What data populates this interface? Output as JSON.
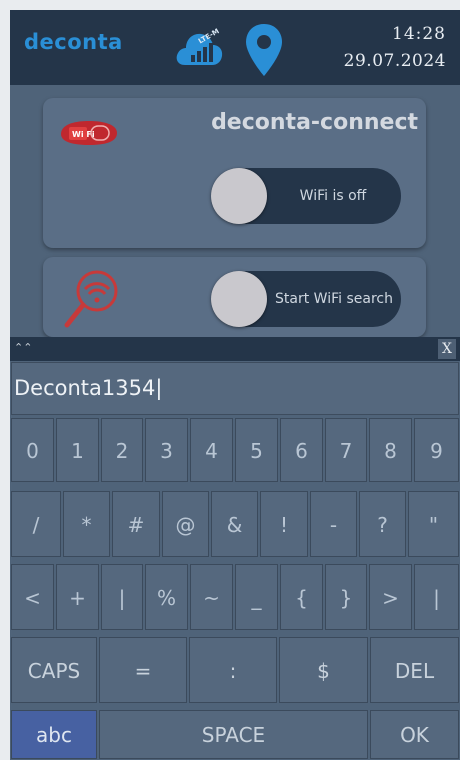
{
  "header": {
    "brand": "deconta",
    "cloud_badge": "LTE-M",
    "time": "14:28",
    "date": "29.07.2024",
    "icons": {
      "cloud": "cloud-signal-icon",
      "location": "location-pin-icon"
    },
    "colors": {
      "brand": "#2a8fd6",
      "bar": "#243549"
    }
  },
  "panel_wifi": {
    "title": "deconta-connect",
    "logo_icon": "wifi-logo-icon",
    "logo_text": "Wi Fi",
    "toggle_label": "WiFi is off",
    "toggle_on": false
  },
  "panel_search": {
    "icon": "wifi-search-icon",
    "toggle_label": "Start WiFi search",
    "toggle_on": false
  },
  "input": {
    "handle": "⌃⌃",
    "close": "X",
    "value": "Deconta1354|"
  },
  "keyboard": {
    "row1": [
      "0",
      "1",
      "2",
      "3",
      "4",
      "5",
      "6",
      "7",
      "8",
      "9"
    ],
    "row2": [
      "/",
      "*",
      "#",
      "@",
      "&",
      "!",
      "-",
      "?",
      "\""
    ],
    "row3": [
      "<",
      "+",
      "|",
      "%",
      "~",
      "_",
      "{",
      "}",
      ">",
      "|"
    ],
    "row4": [
      "CAPS",
      "=",
      ":",
      "$",
      "DEL"
    ],
    "row5": [
      "abc",
      "SPACE",
      "OK"
    ]
  }
}
